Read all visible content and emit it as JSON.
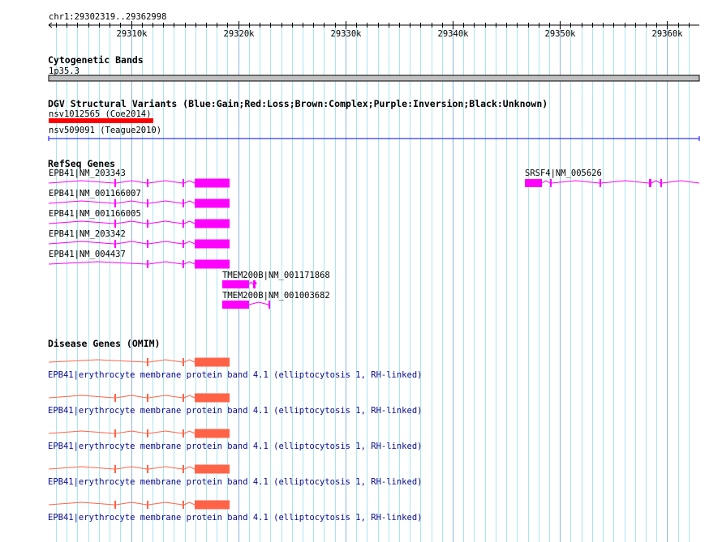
{
  "ruler": {
    "location": "chr1:29302319..29362998",
    "start": 29302319,
    "end": 29362998,
    "tick_labels": [
      "29310k",
      "29320k",
      "29330k",
      "29340k",
      "29350k",
      "29360k"
    ]
  },
  "cytobands": {
    "title": "Cytogenetic Bands",
    "band": "1p35.3"
  },
  "dgv": {
    "title": "DGV Structural Variants (Blue:Gain;Red:Loss;Brown:Complex;Purple:Inversion;Black:Unknown)",
    "variants": [
      {
        "label": "nsv1012565 (Coe2014)",
        "color": "#ff0000"
      },
      {
        "label": "nsv509091 (Teague2010)",
        "color": "#0000ff"
      }
    ]
  },
  "refseq": {
    "title": "RefSeq Genes",
    "color": "#ff00ff",
    "genes": [
      {
        "label": "EPB41|NM_203343"
      },
      {
        "label": "EPB41|NM_001166007"
      },
      {
        "label": "EPB41|NM_001166005"
      },
      {
        "label": "EPB41|NM_203342"
      },
      {
        "label": "EPB41|NM_004437"
      },
      {
        "label": "TMEM200B|NM_001171868"
      },
      {
        "label": "TMEM200B|NM_001003682"
      },
      {
        "label": "SRSF4|NM_005626"
      }
    ]
  },
  "omim": {
    "title": "Disease Genes (OMIM)",
    "color": "#ff6347",
    "entries": [
      {
        "label": "EPB41|erythrocyte membrane protein band 4.1 (elliptocytosis 1, RH-linked)"
      },
      {
        "label": "EPB41|erythrocyte membrane protein band 4.1 (elliptocytosis 1, RH-linked)"
      },
      {
        "label": "EPB41|erythrocyte membrane protein band 4.1 (elliptocytosis 1, RH-linked)"
      },
      {
        "label": "EPB41|erythrocyte membrane protein band 4.1 (elliptocytosis 1, RH-linked)"
      },
      {
        "label": "EPB41|erythrocyte membrane protein band 4.1 (elliptocytosis 1, RH-linked)"
      }
    ]
  }
}
